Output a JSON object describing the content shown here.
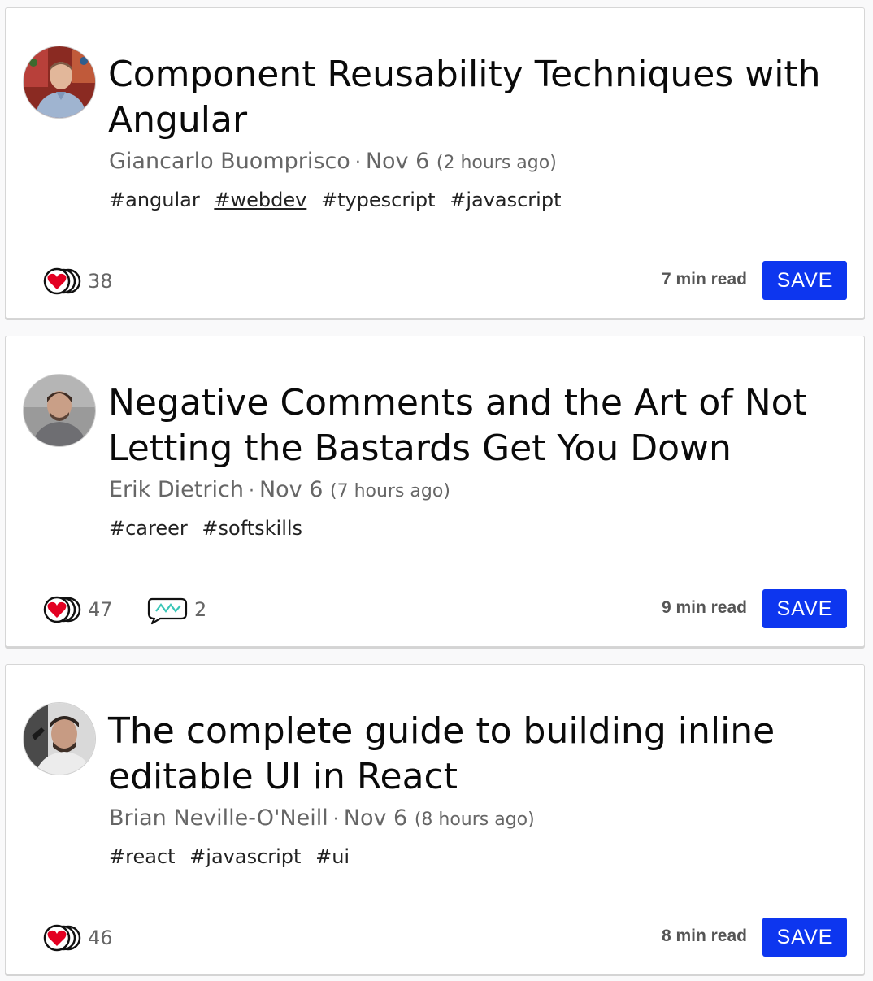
{
  "articles": [
    {
      "title": "Component Reusability Techniques with Angular",
      "author": "Giancarlo Buomprisco",
      "date": "Nov 6",
      "relative": "(2 hours ago)",
      "tags": [
        "#angular",
        "#webdev",
        "#typescript",
        "#javascript"
      ],
      "active_tag": 1,
      "reactions": "38",
      "read_time": "7 min read",
      "save_label": "SAVE"
    },
    {
      "title": "Negative Comments and the Art of Not Letting the Bastards Get You Down",
      "author": "Erik Dietrich",
      "date": "Nov 6",
      "relative": "(7 hours ago)",
      "tags": [
        "#career",
        "#softskills"
      ],
      "reactions": "47",
      "comments": "2",
      "read_time": "9 min read",
      "save_label": "SAVE"
    },
    {
      "title": "The complete guide to building inline editable UI in React",
      "author": "Brian Neville-O'Neill",
      "date": "Nov 6",
      "relative": "(8 hours ago)",
      "tags": [
        "#react",
        "#javascript",
        "#ui"
      ],
      "reactions": "46",
      "read_time": "8 min read",
      "save_label": "SAVE"
    }
  ],
  "colors": {
    "save_button": "#0d36ef",
    "heart": "#e30022",
    "comment_spark": "#38c5b6",
    "meta_text": "#666666"
  },
  "icons": {
    "reactions": "heart-stack-icon",
    "comments": "comment-bubble-icon"
  }
}
